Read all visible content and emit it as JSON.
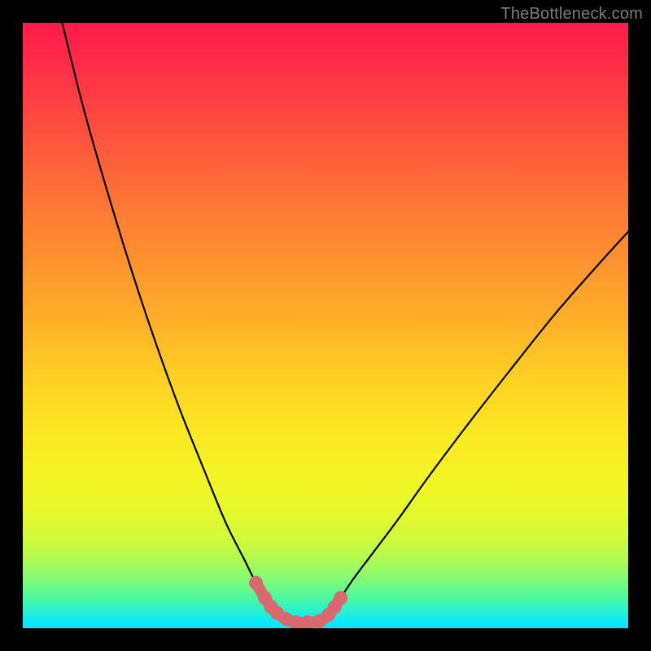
{
  "watermark": "TheBottleneck.com",
  "chart_data": {
    "type": "line",
    "title": "",
    "xlabel": "",
    "ylabel": "",
    "xlim": [
      0,
      1
    ],
    "ylim": [
      0,
      1
    ],
    "series": [
      {
        "name": "bottleneck-curve",
        "x": [
          0.065,
          0.1,
          0.14,
          0.18,
          0.22,
          0.26,
          0.3,
          0.335,
          0.365,
          0.385,
          0.4,
          0.41,
          0.42,
          0.435,
          0.45,
          0.47,
          0.49,
          0.505,
          0.515,
          0.525,
          0.545,
          0.575,
          0.62,
          0.67,
          0.73,
          0.8,
          0.88,
          0.95,
          1.0
        ],
        "y": [
          1.0,
          0.86,
          0.72,
          0.59,
          0.47,
          0.36,
          0.26,
          0.175,
          0.115,
          0.075,
          0.05,
          0.035,
          0.025,
          0.015,
          0.01,
          0.01,
          0.012,
          0.022,
          0.035,
          0.05,
          0.08,
          0.12,
          0.18,
          0.25,
          0.33,
          0.42,
          0.52,
          0.6,
          0.655
        ]
      },
      {
        "name": "valley-highlight",
        "x": [
          0.385,
          0.4,
          0.41,
          0.42,
          0.435,
          0.45,
          0.47,
          0.49,
          0.505,
          0.515,
          0.525
        ],
        "y": [
          0.075,
          0.05,
          0.035,
          0.025,
          0.015,
          0.01,
          0.01,
          0.012,
          0.022,
          0.035,
          0.05
        ]
      }
    ],
    "curve_color": "#000000",
    "highlight_color": "#d86a6f",
    "gradient": {
      "top_color": "#ff1a4b",
      "mid_color": "#f4f424",
      "bottom_color": "#07e2ff"
    }
  }
}
